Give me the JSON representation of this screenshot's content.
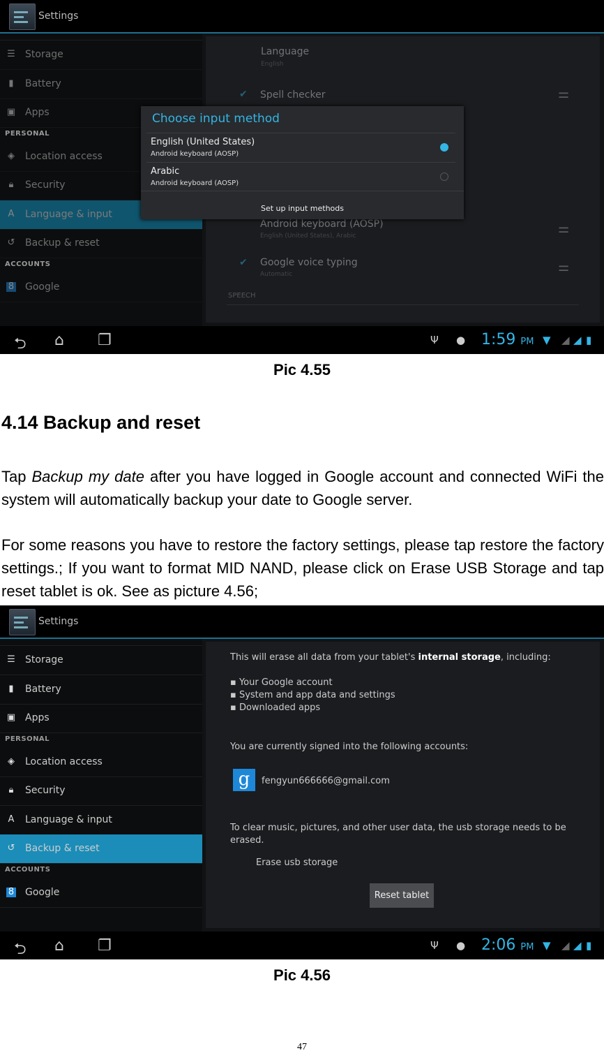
{
  "colors": {
    "accent": "#33b5e5",
    "selected": "#1b8db8"
  },
  "sidebar_items": [
    {
      "type": "item",
      "label": "Storage",
      "icon": "storage-icon"
    },
    {
      "type": "item",
      "label": "Battery",
      "icon": "battery-icon"
    },
    {
      "type": "item",
      "label": "Apps",
      "icon": "apps-icon"
    },
    {
      "type": "section",
      "label": "PERSONAL"
    },
    {
      "type": "item",
      "label": "Location access",
      "icon": "location-icon"
    },
    {
      "type": "item",
      "label": "Security",
      "icon": "lock-icon"
    },
    {
      "type": "item",
      "label": "Language & input",
      "icon": "language-icon"
    },
    {
      "type": "item",
      "label": "Backup & reset",
      "icon": "backup-icon"
    },
    {
      "type": "section",
      "label": "ACCOUNTS"
    },
    {
      "type": "item",
      "label": "Google",
      "icon": "google-icon"
    }
  ],
  "shot1": {
    "title": "Settings",
    "selected": "Language & input",
    "language": "Language",
    "language_value": "English",
    "spell": "Spell checker",
    "kbd": "Android keyboard (AOSP)",
    "kbd_sub": "English (United States), Arabic",
    "voice": "Google voice typing",
    "voice_sub": "Automatic",
    "speech": "SPEECH",
    "dialog": {
      "title": "Choose input method",
      "options": [
        {
          "name": "English (United States)",
          "sub": "Android keyboard (AOSP)",
          "selected": true
        },
        {
          "name": "Arabic",
          "sub": "Android keyboard (AOSP)",
          "selected": false
        }
      ],
      "setup": "Set up input methods"
    },
    "time": "1:59",
    "ampm": "PM"
  },
  "caption1": "Pic 4.55",
  "heading": "4.14 Backup and reset",
  "para1": {
    "pre": "Tap ",
    "em": "Backup my date",
    "post": " after you have logged in Google account and connected WiFi the system will automatically backup your date to Google server."
  },
  "para2": "For some reasons you have to restore the factory settings, please tap restore the factory settings.; If you want to format MID NAND, please click on Erase USB Storage and tap reset tablet is ok. See as picture 4.56;",
  "shot2": {
    "title": "Settings",
    "selected": "Backup & reset",
    "erase_pre": "This will erase all data from your tablet's ",
    "erase_bold": "internal storage",
    "erase_post": ", including:",
    "bullets": [
      "Your Google account",
      "System and app data and settings",
      "Downloaded apps"
    ],
    "signed": "You are currently signed into the following accounts:",
    "account": "fengyun666666@gmail.com",
    "clear": "To clear music, pictures, and other user data, the usb storage needs to be erased.",
    "erase_usb": "Erase usb storage",
    "reset": "Reset tablet",
    "time": "2:06",
    "ampm": "PM"
  },
  "caption2": "Pic 4.56",
  "page_number": "47"
}
